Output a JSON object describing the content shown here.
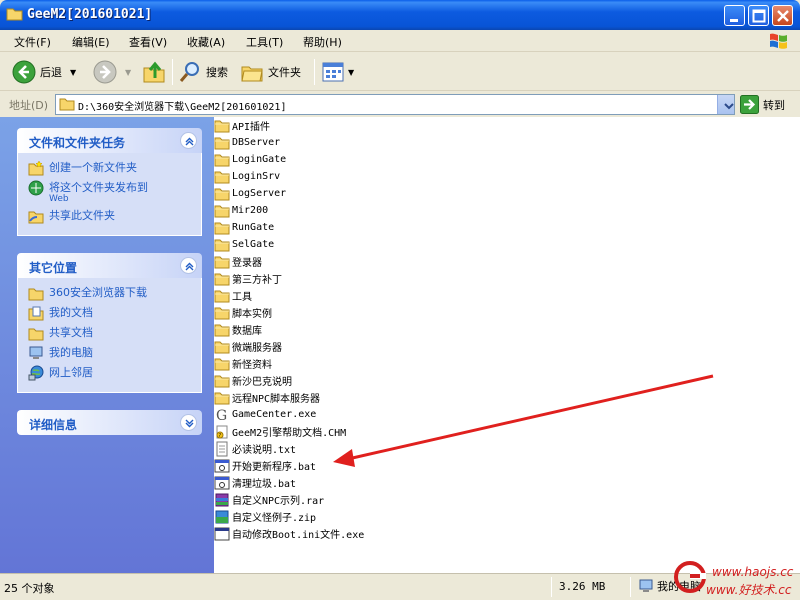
{
  "window": {
    "title": "GeeM2[201601021]"
  },
  "menu": [
    "文件(F)",
    "编辑(E)",
    "查看(V)",
    "收藏(A)",
    "工具(T)",
    "帮助(H)"
  ],
  "toolbar": {
    "back_label": "后退",
    "search_label": "搜索",
    "folders_label": "文件夹"
  },
  "address": {
    "label": "地址(D)",
    "path": "D:\\360安全浏览器下载\\GeeM2[201601021]",
    "go_label": "转到"
  },
  "tasks_panel": {
    "title": "文件和文件夹任务",
    "items": [
      {
        "label": "创建一个新文件夹",
        "icon": "new-folder-icon"
      },
      {
        "label": "将这个文件夹发布到",
        "sub": "Web",
        "icon": "publish-web-icon"
      },
      {
        "label": "共享此文件夹",
        "icon": "share-folder-icon"
      }
    ]
  },
  "places_panel": {
    "title": "其它位置",
    "items": [
      {
        "label": "360安全浏览器下载",
        "icon": "folder-icon"
      },
      {
        "label": "我的文档",
        "icon": "my-documents-icon"
      },
      {
        "label": "共享文档",
        "icon": "folder-icon"
      },
      {
        "label": "我的电脑",
        "icon": "my-computer-icon"
      },
      {
        "label": "网上邻居",
        "icon": "network-places-icon"
      }
    ]
  },
  "details_panel": {
    "title": "详细信息"
  },
  "files": [
    {
      "name": "API插件",
      "type": "folder"
    },
    {
      "name": "DBServer",
      "type": "folder"
    },
    {
      "name": "LoginGate",
      "type": "folder"
    },
    {
      "name": "LoginSrv",
      "type": "folder"
    },
    {
      "name": "LogServer",
      "type": "folder"
    },
    {
      "name": "Mir200",
      "type": "folder"
    },
    {
      "name": "RunGate",
      "type": "folder"
    },
    {
      "name": "SelGate",
      "type": "folder"
    },
    {
      "name": "登录器",
      "type": "folder"
    },
    {
      "name": "第三方补丁",
      "type": "folder"
    },
    {
      "name": "工具",
      "type": "folder"
    },
    {
      "name": "脚本实例",
      "type": "folder"
    },
    {
      "name": "数据库",
      "type": "folder"
    },
    {
      "name": "微端服务器",
      "type": "folder"
    },
    {
      "name": "新怪资料",
      "type": "folder"
    },
    {
      "name": "新沙巴克说明",
      "type": "folder"
    },
    {
      "name": "远程NPC脚本服务器",
      "type": "folder"
    },
    {
      "name": "GameCenter.exe",
      "type": "exe-g"
    },
    {
      "name": "GeeM2引擎帮助文档.CHM",
      "type": "chm"
    },
    {
      "name": "必读说明.txt",
      "type": "txt"
    },
    {
      "name": "开始更新程序.bat",
      "type": "bat"
    },
    {
      "name": "清理垃圾.bat",
      "type": "bat"
    },
    {
      "name": "自定义NPC示列.rar",
      "type": "rar"
    },
    {
      "name": "自定义怪例子.zip",
      "type": "zip"
    },
    {
      "name": "自动修改Boot.ini文件.exe",
      "type": "exe"
    }
  ],
  "status": {
    "count": "25 个对象",
    "size": "3.26 MB",
    "location": "我的电脑"
  },
  "watermark": {
    "line1": "www.haojs.cc",
    "line2": "www.好技术.cc"
  },
  "colors": {
    "title_blue": "#0854d6",
    "link_blue": "#215dc6",
    "arrow_red": "#e0201e"
  }
}
